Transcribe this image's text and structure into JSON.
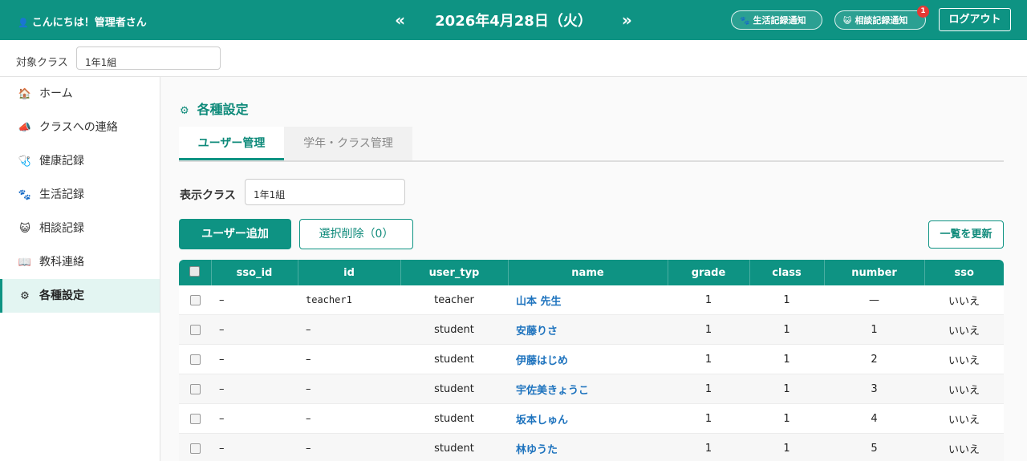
{
  "header": {
    "greeting": "こんにちは！管理者さん",
    "greeting_icon": "person-icon",
    "date": "2026年4月28日（火）",
    "prev_arrow": "«",
    "next_arrow": "»",
    "life_notify_label": "生活記録通知",
    "life_notify_icon": "🐾",
    "consult_notify_label": "相談記録通知",
    "consult_notify_icon": "😺",
    "consult_badge_count": "1",
    "logout_label": "ログアウト"
  },
  "class_bar": {
    "label": "対象クラス",
    "selected_value": "1年1組"
  },
  "sidebar": {
    "items": [
      {
        "icon": "🏠",
        "label": "ホーム"
      },
      {
        "icon": "📣",
        "label": "クラスへの連絡"
      },
      {
        "icon": "🩺",
        "label": "健康記録"
      },
      {
        "icon": "🐾",
        "label": "生活記録"
      },
      {
        "icon": "😺",
        "label": "相談記録"
      },
      {
        "icon": "📖",
        "label": "教科連絡"
      },
      {
        "icon": "⚙",
        "label": "各種設定"
      }
    ]
  },
  "main": {
    "title_icon": "⚙",
    "title": "各種設定",
    "tabs": [
      {
        "label": "ユーザー管理"
      },
      {
        "label": "学年・クラス管理"
      }
    ],
    "display_class_label": "表示クラス",
    "display_class_value": "1年1組",
    "add_user_label": "ユーザー追加",
    "delete_selected_label": "選択削除（0）",
    "refresh_label": "一覧を更新"
  },
  "table": {
    "columns": [
      "sso_id",
      "id",
      "user_typ",
      "name",
      "grade",
      "class",
      "number",
      "sso"
    ],
    "rows": [
      {
        "sso_id": "–",
        "id": "teacher1",
        "user_type": "teacher",
        "name": "山本 先生",
        "grade": "1",
        "class": "1",
        "number": "—",
        "sso": "いいえ"
      },
      {
        "sso_id": "–",
        "id": "–",
        "user_type": "student",
        "name": "安藤りさ",
        "grade": "1",
        "class": "1",
        "number": "1",
        "sso": "いいえ"
      },
      {
        "sso_id": "–",
        "id": "–",
        "user_type": "student",
        "name": "伊藤はじめ",
        "grade": "1",
        "class": "1",
        "number": "2",
        "sso": "いいえ"
      },
      {
        "sso_id": "–",
        "id": "–",
        "user_type": "student",
        "name": "宇佐美きょうこ",
        "grade": "1",
        "class": "1",
        "number": "3",
        "sso": "いいえ"
      },
      {
        "sso_id": "–",
        "id": "–",
        "user_type": "student",
        "name": "坂本しゅん",
        "grade": "1",
        "class": "1",
        "number": "4",
        "sso": "いいえ"
      },
      {
        "sso_id": "–",
        "id": "–",
        "user_type": "student",
        "name": "林ゆうた",
        "grade": "1",
        "class": "1",
        "number": "5",
        "sso": "いいえ"
      }
    ]
  },
  "colors": {
    "brand": "#0e9383",
    "link": "#1e73be",
    "badge": "#e53935"
  }
}
